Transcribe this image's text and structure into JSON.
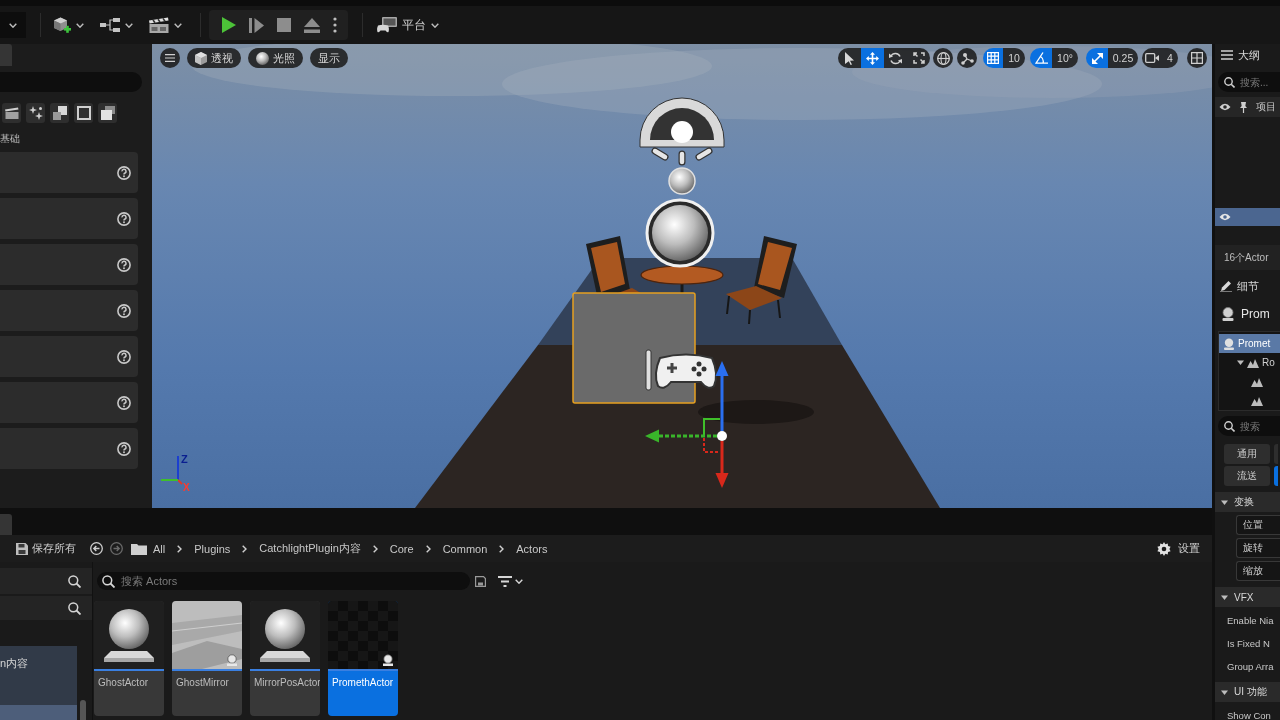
{
  "toolbar": {
    "platform": "平台"
  },
  "place_actors": {
    "category": "基础",
    "items": [
      {
        "help": true
      },
      {
        "help": true
      },
      {
        "help": true
      },
      {
        "help": true
      },
      {
        "help": true
      },
      {
        "help": true
      },
      {
        "help": true
      }
    ]
  },
  "viewport": {
    "view_modes": [
      {
        "label": "透视"
      },
      {
        "label": "光照"
      },
      {
        "label": "显示"
      }
    ],
    "transform_tools": [
      {
        "selected": false
      },
      {
        "selected": true
      },
      {
        "selected": false
      },
      {
        "selected": false
      }
    ],
    "snaps": [
      {
        "value": "10",
        "on": true
      },
      {
        "value": "10°",
        "on": true
      },
      {
        "value": "0.25",
        "on": true
      }
    ],
    "camera_speed": "4",
    "axis_indicator": {
      "up": "Z",
      "right": "X"
    }
  },
  "outliner": {
    "title": "大纲",
    "search_placeholder": "搜索...",
    "column": "项目",
    "rows": [
      {
        "selected": true
      }
    ],
    "count": "16个Actor"
  },
  "details": {
    "title": "细节",
    "actor": "Prom",
    "components": [
      {
        "label": "Promet",
        "selected": true,
        "children": [
          {
            "label": "Ro",
            "selected": false,
            "expanded": true,
            "children": [
              {
                "selected": false
              },
              {
                "selected": false
              }
            ]
          }
        ]
      }
    ],
    "search_placeholder": "搜索",
    "filters": [
      {
        "label": "通用",
        "selected": false
      },
      {
        "selected": false
      },
      {
        "label": "流送",
        "selected": false
      },
      {
        "selected": true
      }
    ],
    "sections": [
      {
        "title": "变换",
        "expanded": true,
        "rows": [
          {
            "kind": "dropdown",
            "label": "位置"
          },
          {
            "kind": "dropdown",
            "label": "旋转"
          },
          {
            "kind": "dropdown",
            "label": "缩放"
          }
        ]
      },
      {
        "title": "VFX",
        "expanded": true,
        "rows": [
          {
            "kind": "property",
            "label": "Enable Nia"
          },
          {
            "kind": "property",
            "label": "Is Fixed N"
          },
          {
            "kind": "property",
            "label": "Group Arra"
          }
        ]
      },
      {
        "title": "UI 功能",
        "expanded": true,
        "rows": [
          {
            "kind": "property",
            "label": "Show Con"
          }
        ]
      }
    ]
  },
  "content_browser": {
    "save_all": "保存所有",
    "path": [
      "All",
      "Plugins",
      "CatchlightPlugin内容",
      "Core",
      "Common",
      "Actors"
    ],
    "settings": "设置",
    "folders": [
      {
        "label": "n内容",
        "selected": false
      },
      {
        "selected": true
      }
    ],
    "search_placeholder": "搜索 Actors",
    "assets": [
      {
        "name": "GhostActor",
        "kind": "sphere",
        "selected": false
      },
      {
        "name": "GhostMirror",
        "kind": "plane",
        "selected": false
      },
      {
        "name": "MirrorPosActor",
        "kind": "sphere",
        "selected": false
      },
      {
        "name": "PromethActor",
        "kind": "empty",
        "selected": true
      }
    ]
  }
}
